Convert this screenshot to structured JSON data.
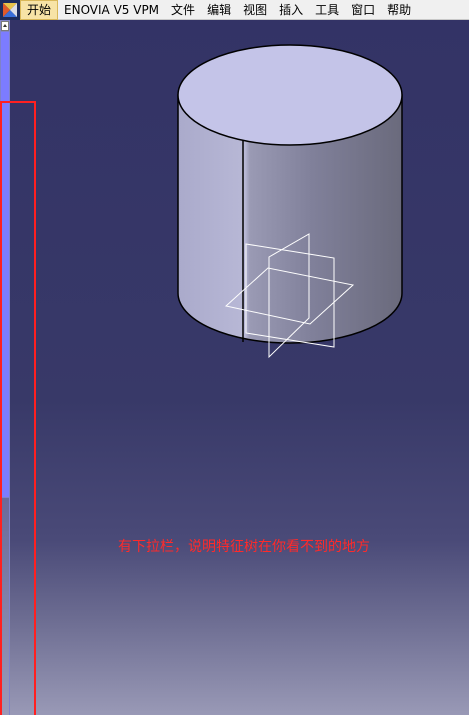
{
  "menubar": {
    "logo_icon": "catia-logo-icon",
    "items": [
      {
        "label": "开始",
        "active": true
      },
      {
        "label": "ENOVIA V5 VPM",
        "active": false
      },
      {
        "label": "文件",
        "active": false
      },
      {
        "label": "编辑",
        "active": false
      },
      {
        "label": "视图",
        "active": false
      },
      {
        "label": "插入",
        "active": false
      },
      {
        "label": "工具",
        "active": false
      },
      {
        "label": "窗口",
        "active": false
      },
      {
        "label": "帮助",
        "active": false
      }
    ]
  },
  "viewport": {
    "annotation_text": "有下拉栏，说明特征树在你看不到的地方",
    "annotation_color": "#ff2a2a",
    "highlight_color": "#ff2020",
    "background_top_color": "#333366",
    "background_bottom_color": "#9999b6"
  },
  "model": {
    "type": "cylinder",
    "top_face_color": "#c4c4e8",
    "side_light_color": "#b4b4d2",
    "side_dark_color": "#6e6e80",
    "planes_color": "#ffffff"
  }
}
